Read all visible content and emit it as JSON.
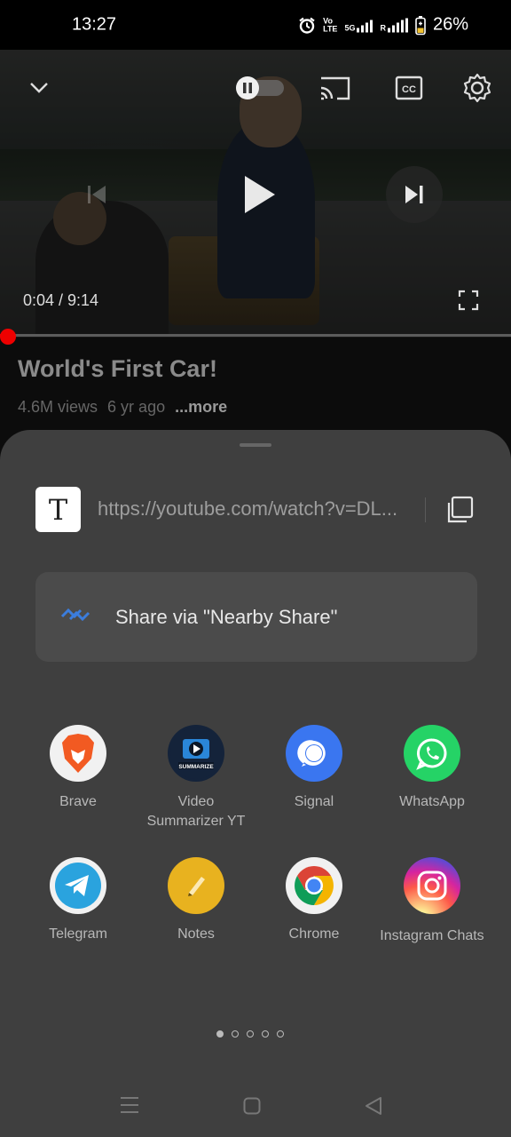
{
  "status_bar": {
    "time": "13:27",
    "volte": "Vo\nLTE",
    "network": "5G",
    "roaming": "R",
    "battery": "26%"
  },
  "player": {
    "current_time": "0:04",
    "duration": "9:14",
    "time_display": "0:04 / 9:14",
    "progress": 0.007
  },
  "video": {
    "title": "World's First Car!",
    "views": "4.6M views",
    "age": "6 yr ago",
    "more": "...more"
  },
  "share_sheet": {
    "url": "https://youtube.com/watch?v=DL...",
    "url_icon_letter": "T",
    "nearby_share_label": "Share via \"Nearby Share\"",
    "apps": [
      {
        "label": "Brave",
        "icon": "brave-icon",
        "color": "#f3f3f3"
      },
      {
        "label": "Video Summarizer YT",
        "icon": "video-summarizer-icon",
        "color": "#14233a"
      },
      {
        "label": "Signal",
        "icon": "signal-icon",
        "color": "#3a76f0"
      },
      {
        "label": "WhatsApp",
        "icon": "whatsapp-icon",
        "color": "#25d366"
      },
      {
        "label": "Telegram",
        "icon": "telegram-icon",
        "color": "#2aa3de"
      },
      {
        "label": "Notes",
        "icon": "notes-icon",
        "color": "#e8b21f"
      },
      {
        "label": "Chrome",
        "icon": "chrome-icon",
        "color": "#f3f3f3"
      },
      {
        "label": "Instagram Chats",
        "icon": "instagram-icon",
        "color": "#d62976"
      }
    ],
    "summarize_badge": "SUMMARIZE",
    "page_count": 5,
    "active_page": 1
  }
}
